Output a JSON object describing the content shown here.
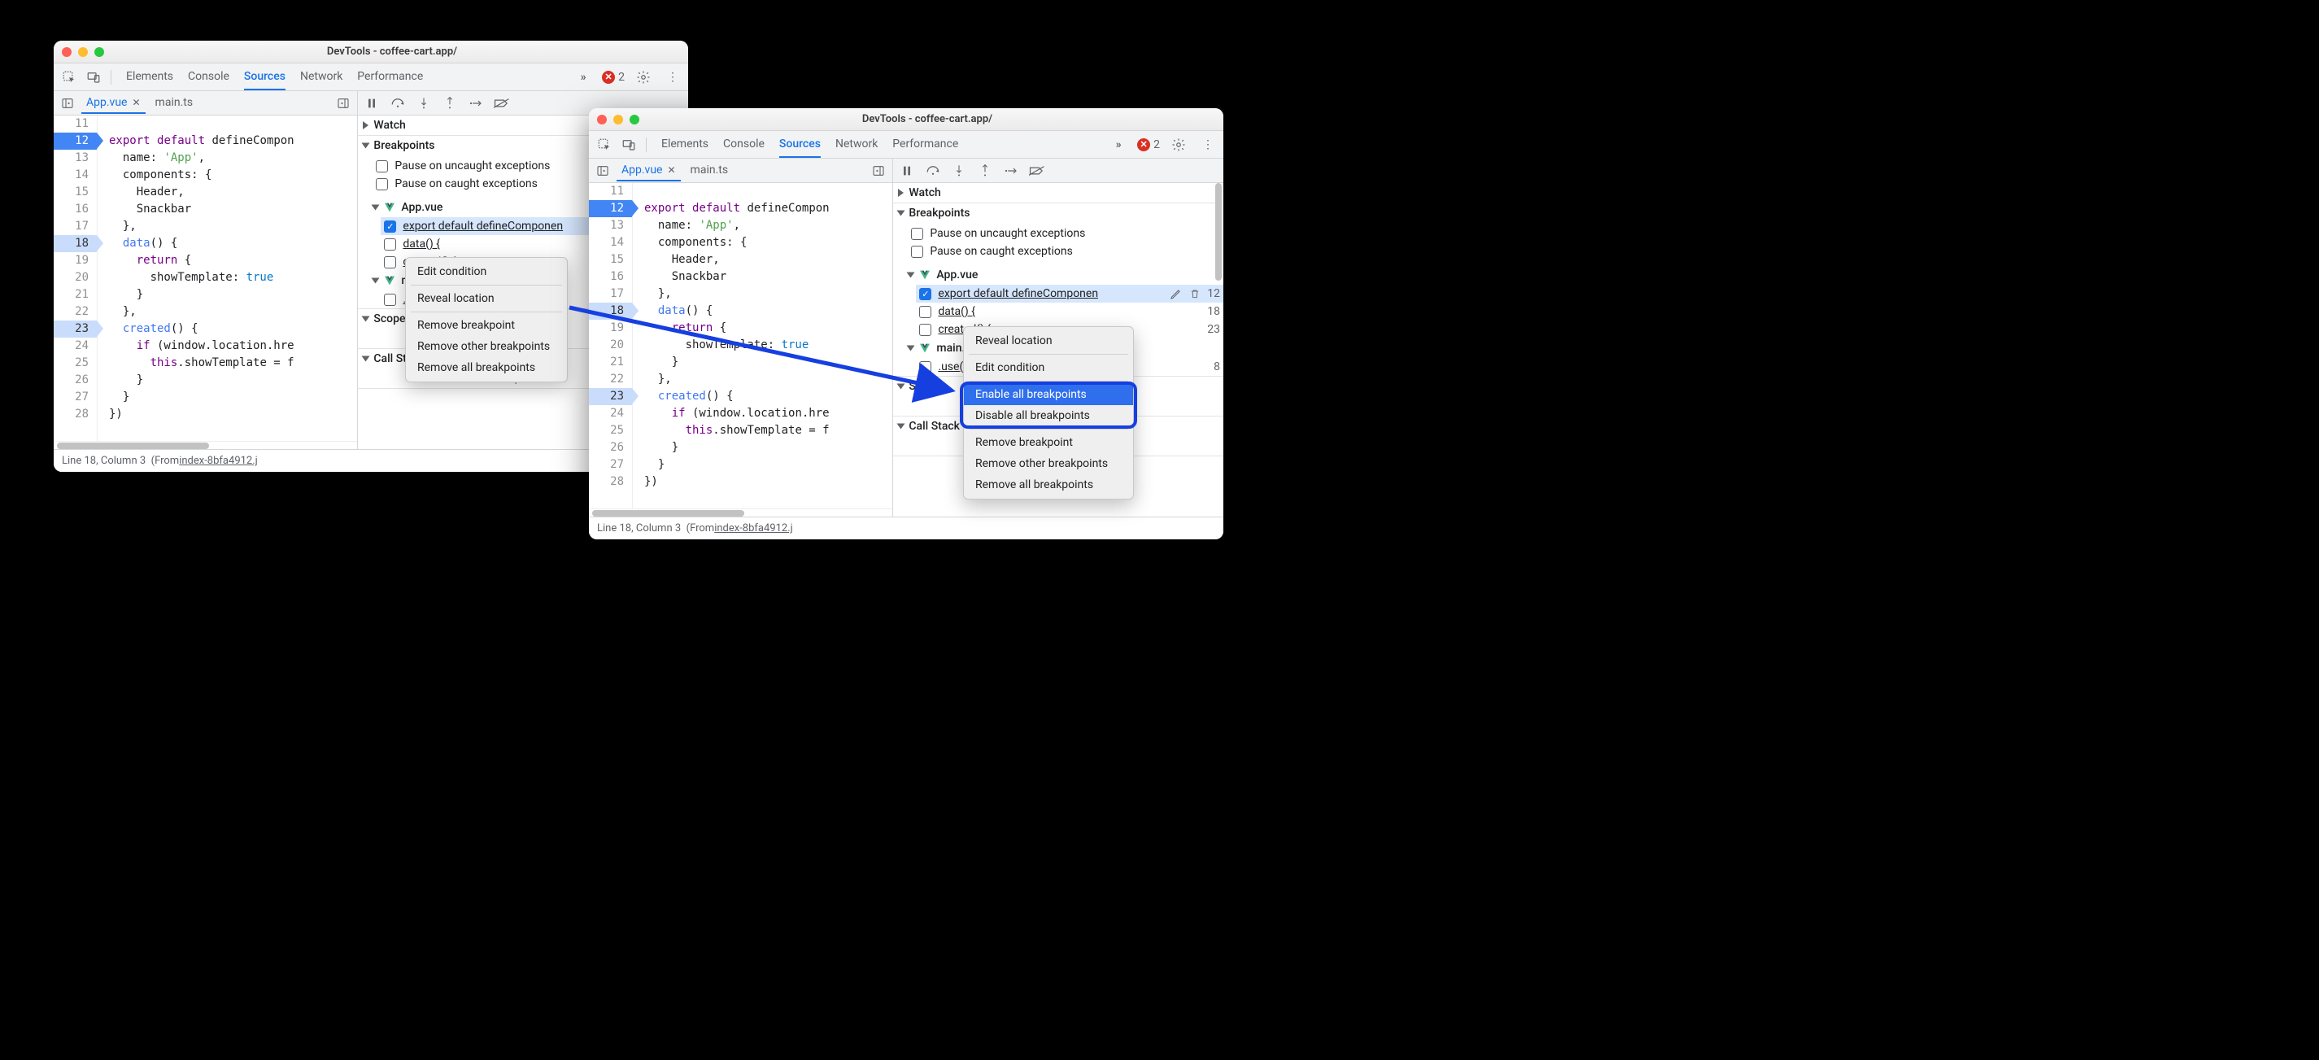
{
  "windowA": {
    "title": "DevTools - coffee-cart.app/",
    "tabs": [
      "Elements",
      "Console",
      "Sources",
      "Network",
      "Performance"
    ],
    "activeTab": "Sources",
    "errorCount": "2",
    "fileTabs": [
      {
        "name": "App.vue",
        "active": true
      },
      {
        "name": "main.ts",
        "active": false
      }
    ],
    "code": {
      "startLine": 11,
      "lines": [
        {
          "n": 11,
          "bp": "none",
          "html": ""
        },
        {
          "n": 12,
          "bp": "solid",
          "html": "<span class='kw'>export</span> <span class='kw'>default</span> defineCompon"
        },
        {
          "n": 13,
          "bp": "none",
          "html": "  name: <span class='str'>'App'</span>,"
        },
        {
          "n": 14,
          "bp": "none",
          "html": "  components: {"
        },
        {
          "n": 15,
          "bp": "none",
          "html": "    Header,"
        },
        {
          "n": 16,
          "bp": "none",
          "html": "    Snackbar"
        },
        {
          "n": 17,
          "bp": "none",
          "html": "  },"
        },
        {
          "n": 18,
          "bp": "light",
          "html": "  <span class='fn'>data</span>() {"
        },
        {
          "n": 19,
          "bp": "none",
          "html": "    <span class='kw'>return</span> {"
        },
        {
          "n": 20,
          "bp": "none",
          "html": "      showTemplate: <span class='lit'>true</span>"
        },
        {
          "n": 21,
          "bp": "none",
          "html": "    }"
        },
        {
          "n": 22,
          "bp": "none",
          "html": "  },"
        },
        {
          "n": 23,
          "bp": "light",
          "html": "  <span class='fn'>created</span>() {"
        },
        {
          "n": 24,
          "bp": "none",
          "html": "    <span class='kw'>if</span> (window.location.hre"
        },
        {
          "n": 25,
          "bp": "none",
          "html": "      <span class='kw'>this</span>.showTemplate = f"
        },
        {
          "n": 26,
          "bp": "none",
          "html": "    }"
        },
        {
          "n": 27,
          "bp": "none",
          "html": "  }"
        },
        {
          "n": 28,
          "bp": "none",
          "html": "})"
        }
      ]
    },
    "status": {
      "pos": "Line 18, Column 3",
      "from": "(From ",
      "link": "index-8bfa4912.j"
    },
    "debug": {
      "watch": "Watch",
      "breakpoints": "Breakpoints",
      "pauseUncaught": "Pause on uncaught exceptions",
      "pauseCaught": "Pause on caught exceptions",
      "file": "App.vue",
      "bpItems": [
        {
          "label": "export default defineComponen",
          "checked": true,
          "sel": true
        },
        {
          "label": "data() {",
          "checked": false,
          "sel": false
        },
        {
          "label": "created() {",
          "checked": false,
          "sel": false
        }
      ],
      "mainFile": "main.ts",
      "mainBp": ".use(",
      "mainBpChecked": false,
      "scope": "Scope",
      "callstack": "Call Stack",
      "notPaused": "Not paused"
    },
    "ctxMenu": {
      "editCondition": "Edit condition",
      "reveal": "Reveal location",
      "remove": "Remove breakpoint",
      "removeOther": "Remove other breakpoints",
      "removeAll": "Remove all breakpoints"
    }
  },
  "windowB": {
    "title": "DevTools - coffee-cart.app/",
    "tabs": [
      "Elements",
      "Console",
      "Sources",
      "Network",
      "Performance"
    ],
    "activeTab": "Sources",
    "errorCount": "2",
    "fileTabs": [
      {
        "name": "App.vue",
        "active": true
      },
      {
        "name": "main.ts",
        "active": false
      }
    ],
    "status": {
      "pos": "Line 18, Column 3",
      "from": "(From ",
      "link": "index-8bfa4912.j"
    },
    "debug": {
      "watch": "Watch",
      "breakpoints": "Breakpoints",
      "pauseUncaught": "Pause on uncaught exceptions",
      "pauseCaught": "Pause on caught exceptions",
      "file": "App.vue",
      "bpItems": [
        {
          "label": "export default defineComponen",
          "checked": true,
          "sel": true,
          "line": "12"
        },
        {
          "label": "data() {",
          "checked": false,
          "sel": false,
          "line": "18"
        },
        {
          "label": "created() {",
          "checked": false,
          "sel": false,
          "line": "23"
        }
      ],
      "mainFile": "main.ts",
      "mainBp": ".use(",
      "mainBpLine": "8",
      "mainBpChecked": false,
      "scope": "Scope",
      "callstack": "Call Stack",
      "notPaused": "Not paused"
    },
    "ctxMenu": {
      "reveal": "Reveal location",
      "editCondition": "Edit condition",
      "enableAll": "Enable all breakpoints",
      "disableAll": "Disable all breakpoints",
      "remove": "Remove breakpoint",
      "removeOther": "Remove other breakpoints",
      "removeAll": "Remove all breakpoints"
    }
  }
}
